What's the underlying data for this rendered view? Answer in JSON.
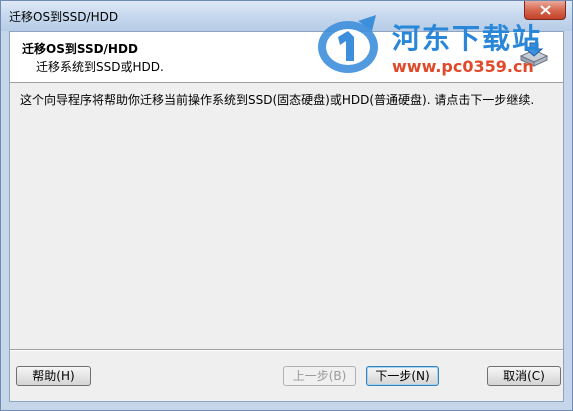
{
  "window": {
    "title": "迁移OS到SSD/HDD"
  },
  "watermark": {
    "site_name": "河东下载站",
    "url": "www.pc0359.cn"
  },
  "header": {
    "title": "迁移OS到SSD/HDD",
    "subtitle": "迁移系统到SSD或HDD."
  },
  "body": {
    "description": "这个向导程序将帮助你迁移当前操作系统到SSD(固态硬盘)或HDD(普通硬盘). 请点击下一步继续."
  },
  "buttons": {
    "help": "帮助(H)",
    "prev": "上一步(B)",
    "next": "下一步(N)",
    "cancel": "取消(C)"
  },
  "colors": {
    "accent": "#2a87d8",
    "url": "#e04a2a",
    "close": "#c3422a"
  }
}
